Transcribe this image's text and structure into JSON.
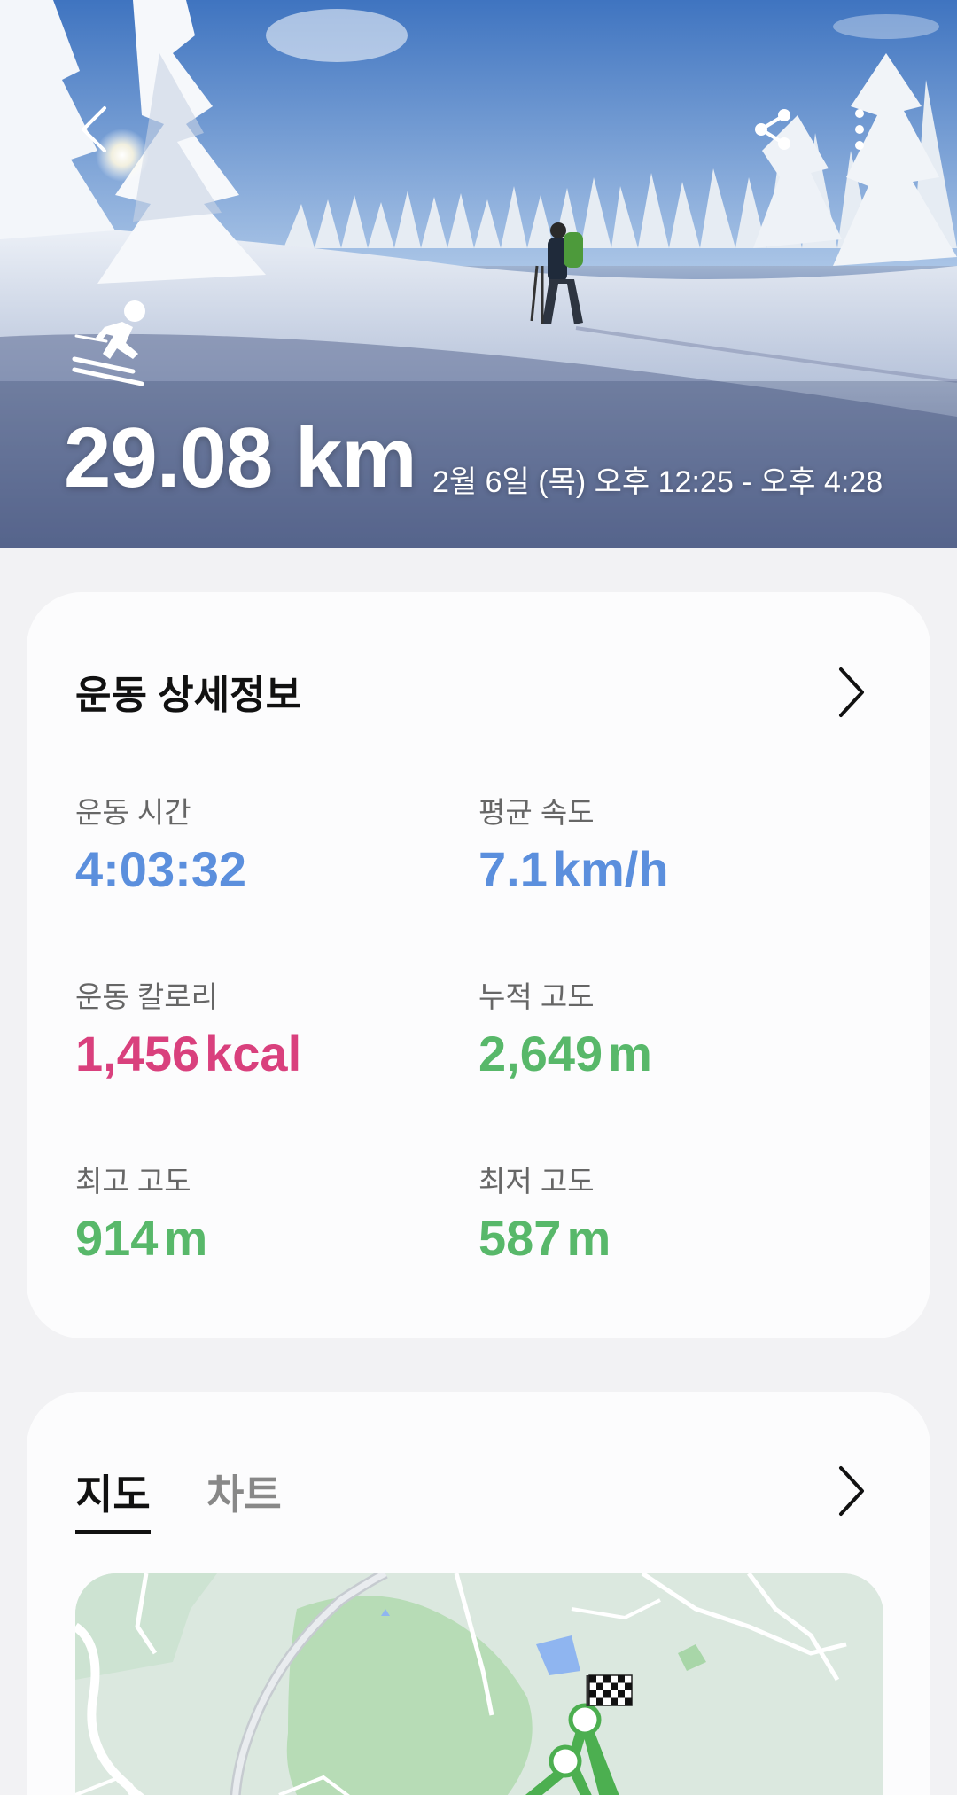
{
  "hero": {
    "distance": "29.08 km",
    "datetime": "2월 6일 (목) 오후 12:25 - 오후 4:28",
    "icons": {
      "back": "back-arrow-icon",
      "share": "share-icon",
      "more": "more-vertical-icon",
      "sport": "skiing-icon"
    }
  },
  "details": {
    "title": "운동 상세정보",
    "stats": [
      {
        "label": "운동 시간",
        "value": "4:03:32",
        "unit": "",
        "color": "#5b8fdd"
      },
      {
        "label": "평균 속도",
        "value": "7.1",
        "unit": "km/h",
        "color": "#5b8fdd"
      },
      {
        "label": "운동 칼로리",
        "value": "1,456",
        "unit": "kcal",
        "color": "#d9407d"
      },
      {
        "label": "누적 고도",
        "value": "2,649",
        "unit": "m",
        "color": "#58b86a"
      },
      {
        "label": "최고 고도",
        "value": "914",
        "unit": "m",
        "color": "#58b86a"
      },
      {
        "label": "최저 고도",
        "value": "587",
        "unit": "m",
        "color": "#58b86a"
      }
    ]
  },
  "map_card": {
    "tabs": [
      {
        "label": "지도",
        "active": true
      },
      {
        "label": "차트",
        "active": false
      }
    ],
    "route_color": "#4caf50",
    "finish_icon": "checkered-flag-icon"
  }
}
